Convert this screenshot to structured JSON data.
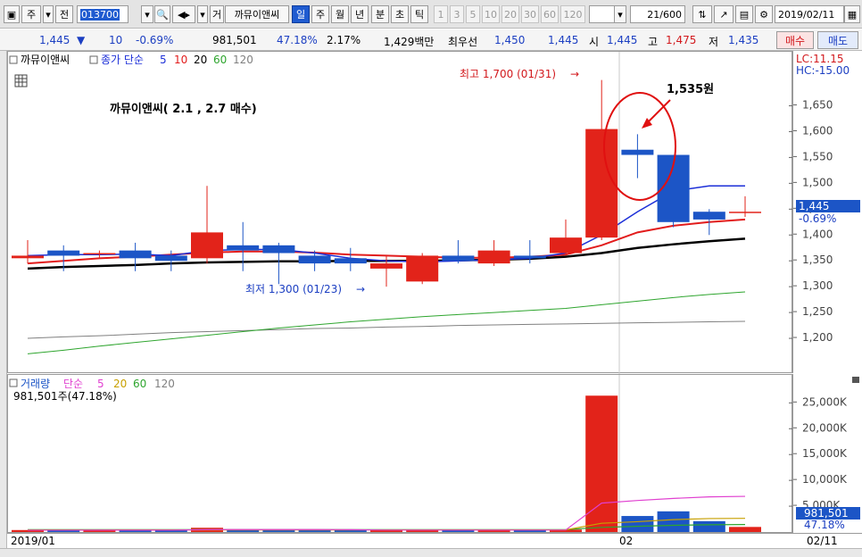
{
  "toolbar": {
    "market": "주",
    "prev_label": "전",
    "code": "013700",
    "mode_label": "거",
    "stock_name": "까뮤이앤씨",
    "periods": [
      "일",
      "주",
      "월",
      "년",
      "분",
      "초",
      "틱"
    ],
    "active_period": "일",
    "intervals": [
      "1",
      "3",
      "5",
      "10",
      "20",
      "30",
      "60",
      "120"
    ],
    "count": "21",
    "count_total": "/600",
    "date": "2019/02/11"
  },
  "quote": {
    "price": "1,445",
    "change": "10",
    "change_rate": "-0.69%",
    "volume": "981,501",
    "ratio": "47.18%",
    "rate2": "2.17%",
    "amount": "1,429백만",
    "best_bid_label": "최우선",
    "best_bid": "1,450",
    "best_ask": "1,445",
    "open_label": "시",
    "open": "1,445",
    "high_label": "고",
    "high": "1,475",
    "low_label": "저",
    "low": "1,435",
    "buy_label": "매수",
    "sell_label": "매도"
  },
  "price_panel": {
    "title": "까뮤이앤씨",
    "ma_label": "종가 단순",
    "ma_periods": [
      "5",
      "10",
      "20",
      "60",
      "120"
    ],
    "annotation_title": "까뮤이앤씨( 2.1 , 2.7 매수)",
    "high_note": "최고 1,700 (01/31)",
    "low_note": "최저 1,300 (01/23)",
    "callout": "1,535원",
    "lc": "LC:11.15",
    "hc": "HC:-15.00",
    "last_price": "1,445",
    "last_rate": "-0.69%"
  },
  "volume_panel": {
    "title": "거래량",
    "ma_label": "단순",
    "ma_periods": [
      "5",
      "20",
      "60",
      "120"
    ],
    "subtitle": "981,501주(47.18%)",
    "last_volume": "981,501",
    "last_rate": "47.18%"
  },
  "x_axis": {
    "start": "2019/01",
    "mid": "02",
    "end": "02/11"
  },
  "chart_data": {
    "type": "candlestick",
    "price_axis": {
      "ticks": [
        1200,
        1250,
        1300,
        1350,
        1400,
        1450,
        1500,
        1550,
        1600,
        1650
      ],
      "range": [
        1150,
        1720
      ]
    },
    "candles": [
      {
        "o": 1355,
        "c": 1360,
        "h": 1390,
        "l": 1345
      },
      {
        "o": 1370,
        "c": 1360,
        "h": 1380,
        "l": 1330
      },
      {
        "o": 1365,
        "c": 1365,
        "h": 1370,
        "l": 1355
      },
      {
        "o": 1370,
        "c": 1355,
        "h": 1385,
        "l": 1330
      },
      {
        "o": 1360,
        "c": 1350,
        "h": 1370,
        "l": 1330
      },
      {
        "o": 1355,
        "c": 1405,
        "h": 1495,
        "l": 1345
      },
      {
        "o": 1380,
        "c": 1370,
        "h": 1425,
        "l": 1330
      },
      {
        "o": 1380,
        "c": 1365,
        "h": 1385,
        "l": 1305
      },
      {
        "o": 1360,
        "c": 1345,
        "h": 1370,
        "l": 1330
      },
      {
        "o": 1355,
        "c": 1345,
        "h": 1375,
        "l": 1330
      },
      {
        "o": 1335,
        "c": 1345,
        "h": 1360,
        "l": 1300
      },
      {
        "o": 1310,
        "c": 1360,
        "h": 1365,
        "l": 1305
      },
      {
        "o": 1360,
        "c": 1350,
        "h": 1390,
        "l": 1345
      },
      {
        "o": 1345,
        "c": 1370,
        "h": 1390,
        "l": 1340
      },
      {
        "o": 1360,
        "c": 1355,
        "h": 1390,
        "l": 1345
      },
      {
        "o": 1365,
        "c": 1395,
        "h": 1430,
        "l": 1360
      },
      {
        "o": 1395,
        "c": 1605,
        "h": 1700,
        "l": 1390
      },
      {
        "o": 1565,
        "c": 1555,
        "h": 1595,
        "l": 1510
      },
      {
        "o": 1555,
        "c": 1425,
        "h": 1555,
        "l": 1415
      },
      {
        "o": 1445,
        "c": 1430,
        "h": 1450,
        "l": 1400
      },
      {
        "o": 1445,
        "c": 1445,
        "h": 1475,
        "l": 1435
      }
    ],
    "ma": {
      "5": [
        1360,
        1362,
        1362,
        1363,
        1360,
        1370,
        1372,
        1372,
        1365,
        1355,
        1350,
        1348,
        1350,
        1352,
        1355,
        1365,
        1400,
        1445,
        1485,
        1495,
        1495
      ],
      "10": [
        1345,
        1350,
        1355,
        1358,
        1362,
        1366,
        1368,
        1368,
        1366,
        1362,
        1360,
        1358,
        1356,
        1356,
        1358,
        1362,
        1380,
        1405,
        1418,
        1425,
        1430
      ],
      "20": [
        1335,
        1338,
        1340,
        1342,
        1345,
        1347,
        1348,
        1349,
        1349,
        1350,
        1350,
        1350,
        1351,
        1352,
        1354,
        1358,
        1365,
        1375,
        1382,
        1388,
        1393
      ],
      "60": [
        1170,
        1177,
        1185,
        1192,
        1199,
        1206,
        1213,
        1220,
        1226,
        1232,
        1237,
        1242,
        1246,
        1250,
        1254,
        1258,
        1265,
        1272,
        1279,
        1285,
        1290
      ],
      "120": [
        1200,
        1203,
        1205,
        1208,
        1211,
        1213,
        1215,
        1217,
        1219,
        1220,
        1222,
        1223,
        1225,
        1226,
        1227,
        1228,
        1229,
        1230,
        1231,
        1232,
        1233
      ]
    },
    "volume_axis": {
      "ticks": [
        5000,
        10000,
        15000,
        20000,
        25000
      ],
      "unit": "K",
      "range": [
        0,
        28000
      ]
    },
    "volume": [
      380,
      350,
      360,
      400,
      370,
      820,
      420,
      380,
      370,
      360,
      380,
      400,
      370,
      390,
      380,
      470,
      26400,
      3100,
      4000,
      2100,
      981
    ],
    "volume_ma": {
      "5": [
        360,
        360,
        365,
        370,
        372,
        460,
        480,
        470,
        470,
        460,
        380,
        380,
        380,
        380,
        380,
        400,
        5600,
        6100,
        6500,
        6800,
        6900
      ],
      "20": [
        400,
        402,
        404,
        405,
        406,
        410,
        412,
        414,
        415,
        416,
        418,
        418,
        420,
        420,
        422,
        425,
        1700,
        2000,
        2400,
        2600,
        2650
      ],
      "60": [
        450,
        451,
        452,
        452,
        453,
        455,
        456,
        457,
        458,
        459,
        460,
        460,
        461,
        462,
        462,
        463,
        900,
        1100,
        1300,
        1400,
        1450
      ]
    }
  },
  "colors": {
    "up": "#e2231a",
    "down": "#1c55c6",
    "ma5": "#1c2fd8",
    "ma10": "#e21c1c",
    "ma20": "#000000",
    "ma60": "#2ea52e",
    "ma120": "#808080",
    "vma5": "#e040d0",
    "vma20": "#c8a000",
    "vma60": "#2ea52e"
  }
}
